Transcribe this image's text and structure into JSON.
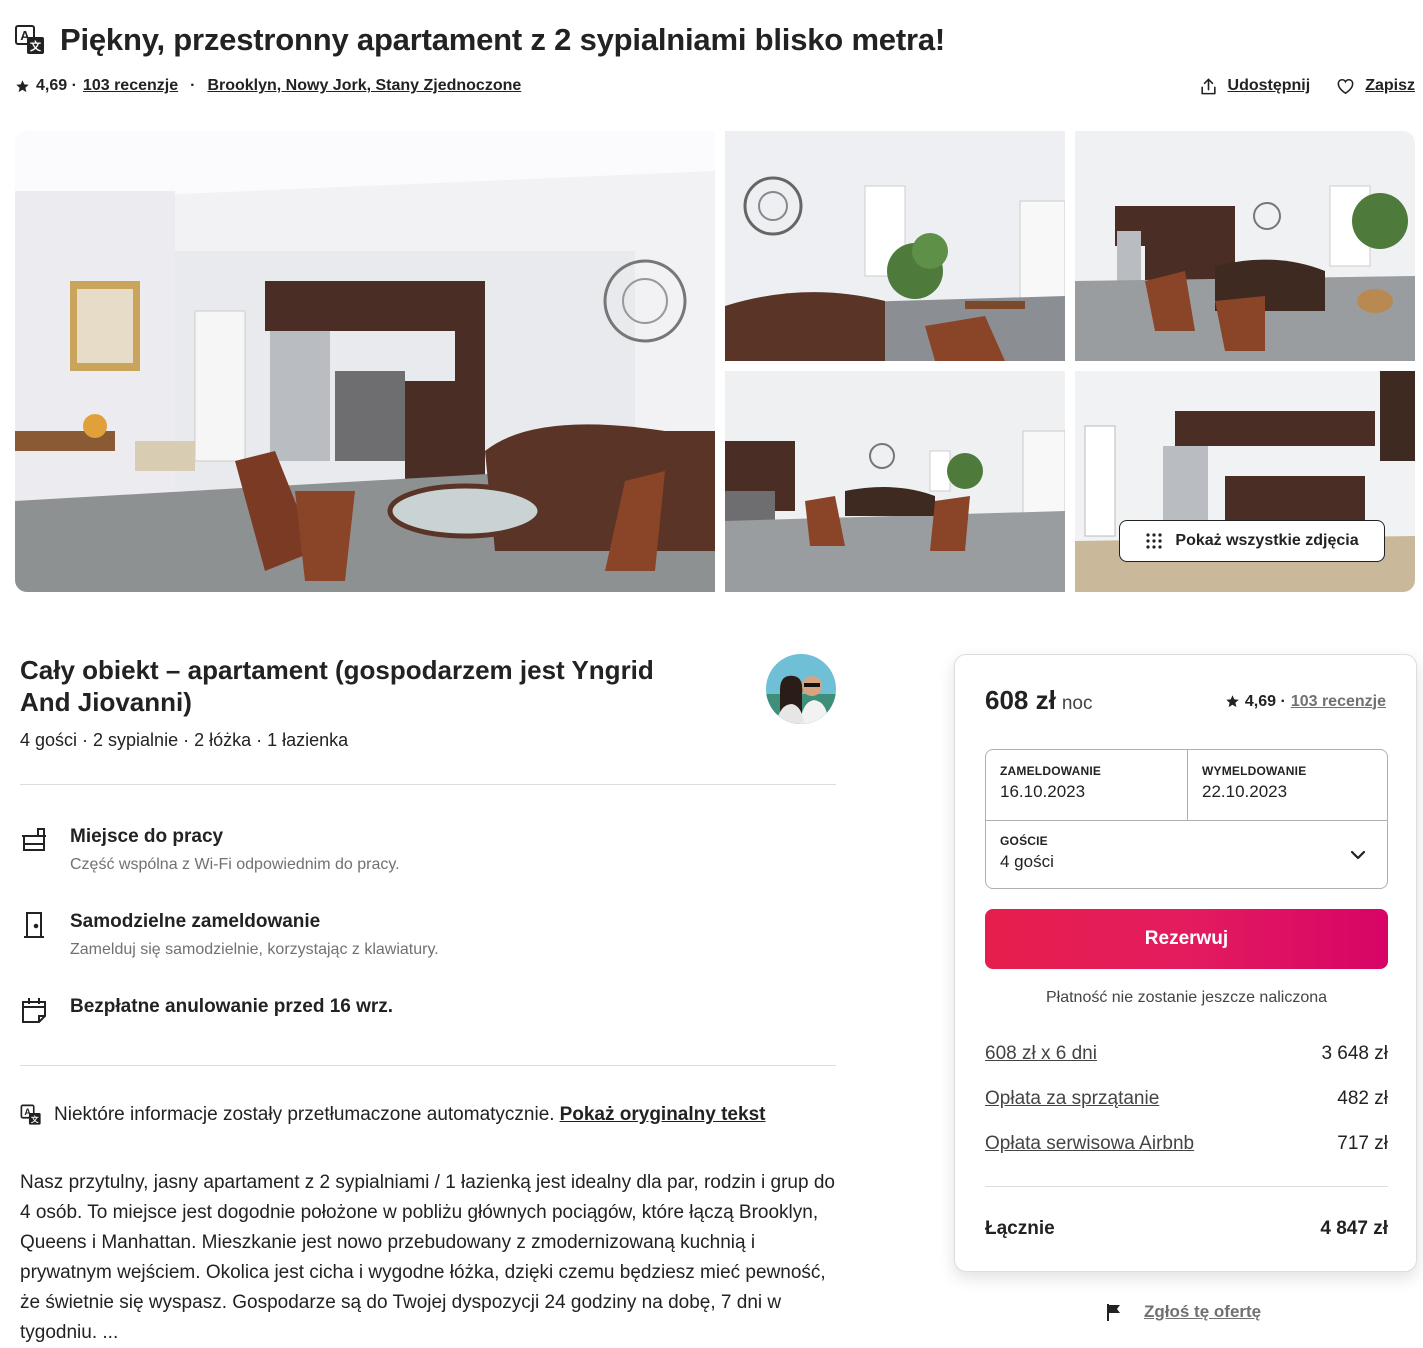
{
  "header": {
    "title": "Piękny, przestronny apartament z 2 sypialniami blisko metra!",
    "rating": "4,69 ·",
    "reviews_link": "103 recenzje",
    "separator": "·",
    "location_link": "Brooklyn, Nowy Jork, Stany Zjednoczone",
    "share_label": "Udostępnij",
    "save_label": "Zapisz",
    "translate_icon": "translate-icon",
    "share_icon": "share-icon",
    "heart_icon": "heart-icon",
    "star_icon": "star-icon"
  },
  "gallery": {
    "show_all_label": "Pokaż wszystkie zdjęcia",
    "grid_icon": "grid-dots-icon",
    "photos": [
      "living-room-kitchen",
      "sofa-plant-window",
      "kitchen-sofa-chairs",
      "wide-living-room",
      "kitchen-bathroom"
    ]
  },
  "listing": {
    "title": "Cały obiekt – apartament (gospodarzem jest Yngrid And Jiovanni)",
    "subtitle": "4 gości · 2 sypialnie · 2 łóżka · 1 łazienka",
    "host_avatar": "host-avatar",
    "features": [
      {
        "icon": "workspace-icon",
        "title": "Miejsce do pracy",
        "desc": "Część wspólna z Wi-Fi odpowiednim do pracy."
      },
      {
        "icon": "door-icon",
        "title": "Samodzielne zameldowanie",
        "desc": "Zamelduj się samodzielnie, korzystając z klawiatury."
      },
      {
        "icon": "calendar-icon",
        "title": "Bezpłatne anulowanie przed 16 wrz.",
        "desc": ""
      }
    ],
    "translated_note": "Niektóre informacje zostały przetłumaczone automatycznie.",
    "show_original_link": "Pokaż oryginalny tekst",
    "description": "Nasz przytulny, jasny apartament z 2 sypialniami / 1 łazienką jest idealny dla par, rodzin i grup do 4 osób. To miejsce jest dogodnie położone w pobliżu głównych pociągów, które łączą Brooklyn, Queens i Manhattan. Mieszkanie jest nowo przebudowany z zmodernizowaną kuchnią i prywatnym wejściem. Okolica jest cicha i wygodne łóżka, dzięki czemu będziesz mieć pewność, że świetnie się wyspasz. Gospodarze są do Twojej dyspozycji 24 godziny na dobę, 7 dni w tygodniu. ..."
  },
  "booking": {
    "price": "608 zł",
    "per": "noc",
    "rating": "4,69 ·",
    "reviews_link": "103 recenzje",
    "checkin_label": "ZAMELDOWANIE",
    "checkin_value": "16.10.2023",
    "checkout_label": "WYMELDOWANIE",
    "checkout_value": "22.10.2023",
    "guests_label": "GOŚCIE",
    "guests_value": "4 gości",
    "reserve_label": "Rezerwuj",
    "note": "Płatność nie zostanie jeszcze naliczona",
    "fees": [
      {
        "label": "608 zł x 6 dni",
        "value": "3 648 zł"
      },
      {
        "label": "Opłata za sprzątanie",
        "value": "482 zł"
      },
      {
        "label": "Opłata serwisowa Airbnb",
        "value": "717 zł"
      }
    ],
    "total_label": "Łącznie",
    "total_value": "4 847 zł",
    "accent_color": "#e31c5f"
  },
  "report": {
    "label": "Zgłoś tę ofertę",
    "icon": "flag-icon"
  }
}
